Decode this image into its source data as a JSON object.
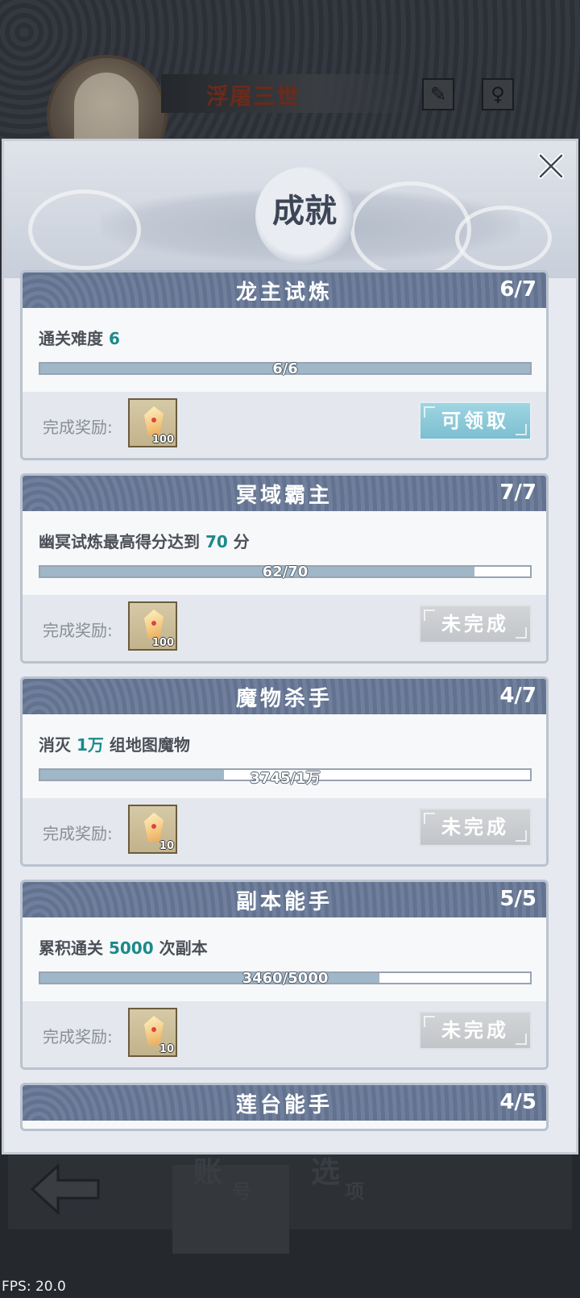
{
  "background": {
    "player_name": "浮屠三世",
    "tabs": [
      {
        "main": "账",
        "sub": "号"
      },
      {
        "main": "选",
        "sub": "项"
      }
    ],
    "fps": "FPS: 20.0",
    "icons": [
      "brush-icon",
      "profile-icon",
      "back-arrow-icon"
    ]
  },
  "dialog": {
    "title": "成就",
    "close_icon": "close-icon",
    "reward_label": "完成奖励:",
    "achievements": [
      {
        "title": "龙主试炼",
        "count": "6/7",
        "task_prefix": "通关难度 ",
        "task_highlight": "6",
        "task_suffix": "",
        "progress_text": "6/6",
        "progress_fraction": 1.0,
        "reward_qty": "100",
        "button": "可领取",
        "button_state": "claimable"
      },
      {
        "title": "冥域霸主",
        "count": "7/7",
        "task_prefix": "幽冥试炼最高得分达到 ",
        "task_highlight": "70",
        "task_suffix": " 分",
        "progress_text": "62/70",
        "progress_fraction": 0.886,
        "reward_qty": "100",
        "button": "未完成",
        "button_state": "incomplete"
      },
      {
        "title": "魔物杀手",
        "count": "4/7",
        "task_prefix": "消灭 ",
        "task_highlight": "1万",
        "task_suffix": " 组地图魔物",
        "progress_text": "3745/1万",
        "progress_fraction": 0.3745,
        "reward_qty": "10",
        "button": "未完成",
        "button_state": "incomplete"
      },
      {
        "title": "副本能手",
        "count": "5/5",
        "task_prefix": "累积通关 ",
        "task_highlight": "5000",
        "task_suffix": " 次副本",
        "progress_text": "3460/5000",
        "progress_fraction": 0.692,
        "reward_qty": "10",
        "button": "未完成",
        "button_state": "incomplete"
      },
      {
        "title": "莲台能手",
        "count": "4/5"
      }
    ]
  },
  "colors": {
    "header_blue": "#6f7f9c",
    "highlight_teal": "#1b8a8a",
    "claim_button": "#8ccbda",
    "disabled_button": "#cacdd1"
  }
}
